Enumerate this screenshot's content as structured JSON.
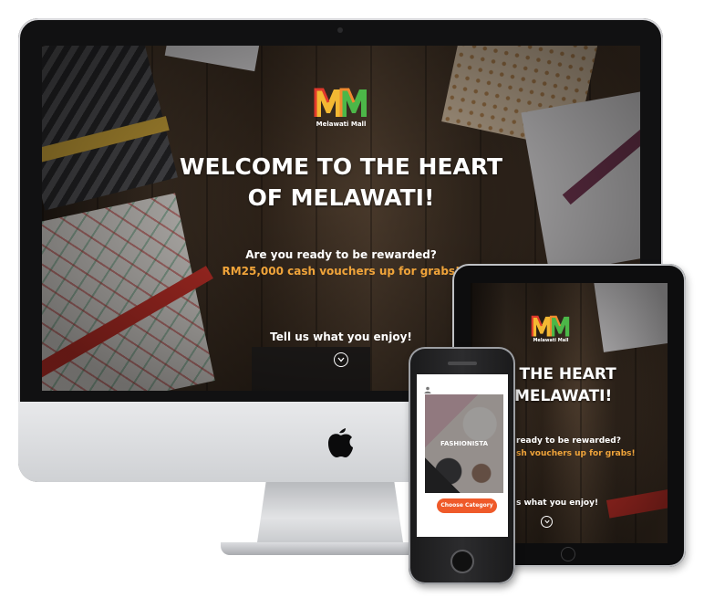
{
  "desktop": {
    "brand_name": "Melawati Mall",
    "headline_line1": "WELCOME TO THE HEART",
    "headline_line2": "OF MELAWATI!",
    "question": "Are you ready to be rewarded?",
    "offer": "RM25,000 cash vouchers up for grabs!",
    "cta_text": "Tell us what you enjoy!",
    "scroll_icon": "chevron-down-icon",
    "brand_logo_letters": "MM"
  },
  "tablet": {
    "brand_name": "Melawati Mall",
    "headline_line1": "E TO THE HEART",
    "headline_line2": "MELAWATI!",
    "question": "ready to be rewarded?",
    "offer": "sh vouchers up for grabs!",
    "cta_text": "s what you enjoy!",
    "scroll_icon": "chevron-down-icon"
  },
  "phone": {
    "category_title": "FASHIONISTA",
    "button_label": "Choose Category",
    "user_icon": "user-icon"
  },
  "colors": {
    "accent_orange": "#f0a43a",
    "button_orange": "#ef5a2a",
    "logo_red": "#e0392b",
    "logo_yellow": "#f3b833",
    "logo_green": "#4cb748"
  },
  "device_icons": {
    "imac_logo": "apple-logo-icon"
  }
}
